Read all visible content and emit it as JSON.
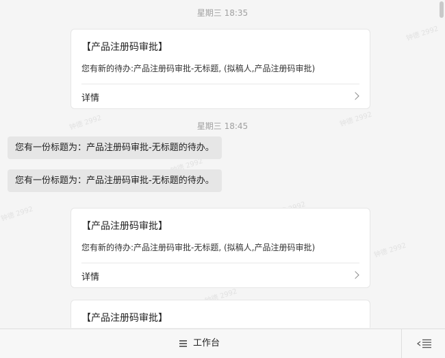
{
  "watermark_text": "钟德 2992",
  "timestamps": [
    "星期三 18:35",
    "星期三 18:45"
  ],
  "cards": [
    {
      "title": "【产品注册码审批】",
      "body": "您有新的待办:产品注册码审批-无标题, (拟稿人,产品注册码审批)",
      "link": "详情"
    },
    {
      "title": "【产品注册码审批】",
      "body": "您有新的待办:产品注册码审批-无标题, (拟稿人,产品注册码审批)",
      "link": "详情"
    },
    {
      "title": "【产品注册码审批】"
    }
  ],
  "messages": [
    "您有一份标题为：产品注册码审批-无标题的待办。",
    "您有一份标题为：产品注册码审批-无标题的待办。"
  ],
  "bottom_bar": {
    "workbench_label": "工作台",
    "workbench_icon": "hamburger-icon",
    "menu_icon": "collapse-menu-icon"
  }
}
